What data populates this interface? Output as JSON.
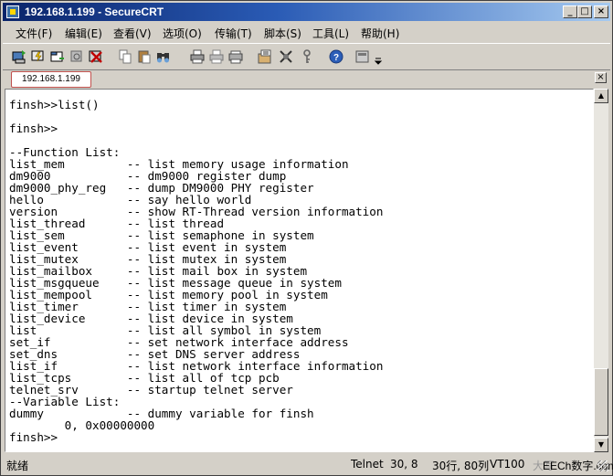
{
  "window": {
    "title": "192.168.1.199 - SecureCRT",
    "caption_buttons": [
      "minimize",
      "maximize",
      "close"
    ]
  },
  "menu": [
    "文件(F)",
    "编辑(E)",
    "查看(V)",
    "选项(O)",
    "传输(T)",
    "脚本(S)",
    "工具(L)",
    "帮助(H)"
  ],
  "toolbar": {
    "icons": [
      "connect-icon",
      "quick-connect-icon",
      "connect-tab-icon",
      "reconnect-icon",
      "disconnect-icon",
      "copy-icon",
      "paste-icon",
      "find-icon",
      "print-icon",
      "print-selection-icon",
      "print-setup-icon",
      "session-options-icon",
      "global-options-icon",
      "key-icon",
      "help-icon",
      "sftp-icon",
      "toolbar-overflow-icon"
    ]
  },
  "tab": {
    "label": "192.168.1.199",
    "close": "×"
  },
  "terminal": {
    "lines": [
      "finsh>>list()",
      "",
      "finsh>>",
      "",
      "--Function List:",
      "list_mem         -- list memory usage information",
      "dm9000           -- dm9000 register dump",
      "dm9000_phy_reg   -- dump DM9000 PHY register",
      "hello            -- say hello world",
      "version          -- show RT-Thread version information",
      "list_thread      -- list thread",
      "list_sem         -- list semaphone in system",
      "list_event       -- list event in system",
      "list_mutex       -- list mutex in system",
      "list_mailbox     -- list mail box in system",
      "list_msgqueue    -- list message queue in system",
      "list_mempool     -- list memory pool in system",
      "list_timer       -- list timer in system",
      "list_device      -- list device in system",
      "list             -- list all symbol in system",
      "set_if           -- set network interface address",
      "set_dns          -- set DNS server address",
      "list_if          -- list network interface information",
      "list_tcps        -- list all of tcp pcb",
      "telnet_srv       -- startup telnet server",
      "--Variable List:",
      "dummy            -- dummy variable for finsh",
      "        0, 0x00000000",
      "finsh>>"
    ]
  },
  "status": {
    "ready": "就绪",
    "protocol": "Telnet",
    "cursor": "30,  8",
    "size": "30行, 80列",
    "emulation": "VT100",
    "caps": "大写",
    "watermark": "EECh数字.com"
  }
}
